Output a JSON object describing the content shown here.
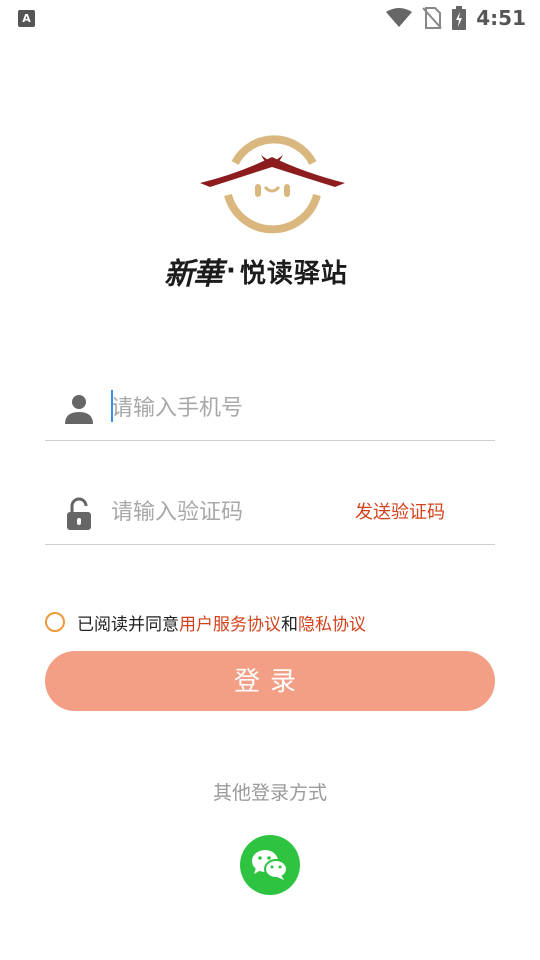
{
  "status_bar": {
    "app_icon_letter": "A",
    "time": "4:51"
  },
  "brand": {
    "script": "新華",
    "dot": "·",
    "name": "悦读驿站"
  },
  "form": {
    "phone_placeholder": "请输入手机号",
    "code_placeholder": "请输入验证码",
    "send_code_label": "发送验证码"
  },
  "agreement": {
    "prefix": "已阅读并同意",
    "user_agreement": "用户服务协议",
    "and": "和",
    "privacy": "隐私协议"
  },
  "login_label": "登录",
  "other_login_label": "其他登录方式",
  "colors": {
    "accent": "#d4421c",
    "button": "#f29f86",
    "wechat": "#2ec441",
    "logo_gold": "#d9b77e",
    "logo_red": "#8d1c1f"
  },
  "icons": [
    "user-icon",
    "lock-icon",
    "wifi-icon",
    "no-sim-icon",
    "battery-icon",
    "wechat-icon"
  ]
}
